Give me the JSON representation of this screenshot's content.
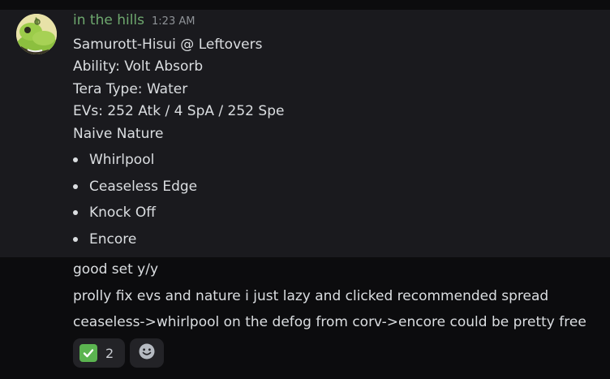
{
  "message": {
    "username": "in the hills",
    "timestamp": "1:23 AM",
    "set_lines": [
      "Samurott-Hisui @ Leftovers",
      "Ability: Volt Absorb",
      "Tera Type: Water",
      "EVs: 252 Atk / 4 SpA / 252 Spe",
      "Naive Nature"
    ],
    "moves": [
      "Whirlpool",
      "Ceaseless Edge",
      "Knock Off",
      "Encore"
    ]
  },
  "followups": [
    "good set y/y",
    "prolly fix evs and nature i just lazy and clicked recommended spread",
    "ceaseless->whirlpool on the defog from corv->encore could be pretty free"
  ],
  "reactions": {
    "check_icon": "white-check-mark-icon",
    "check_count": "2",
    "add_icon": "add-reaction-smiley-icon",
    "colors": {
      "check_green": "#5bb450",
      "username_green": "#6ea86e"
    }
  }
}
